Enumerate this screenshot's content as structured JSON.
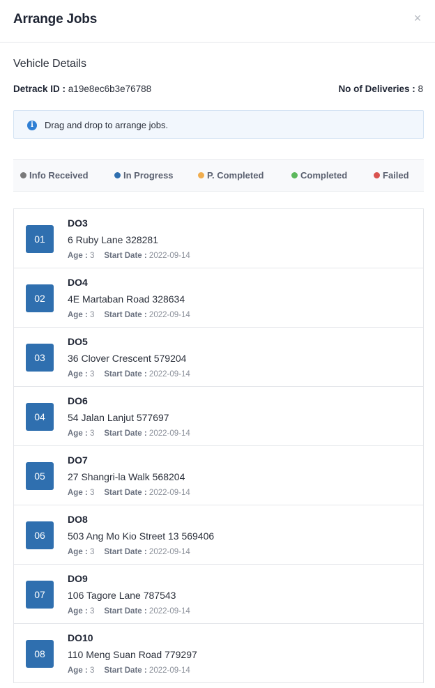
{
  "modal": {
    "title": "Arrange Jobs",
    "close_label": "×"
  },
  "vehicle": {
    "section_title": "Vehicle Details",
    "detrack_label": "Detrack ID :",
    "detrack_id": "a19e8ec6b3e76788",
    "deliveries_label": "No of Deliveries :",
    "deliveries_count": "8"
  },
  "info": {
    "icon": "info-icon",
    "text": "Drag and drop to arrange jobs."
  },
  "legend": [
    {
      "label": "Info Received",
      "color": "#7a7a7a"
    },
    {
      "label": "In Progress",
      "color": "#2f6faf"
    },
    {
      "label": "P. Completed",
      "color": "#f0ad4e"
    },
    {
      "label": "Completed",
      "color": "#5cb85c"
    },
    {
      "label": "Failed",
      "color": "#d9534f"
    }
  ],
  "meta_labels": {
    "age": "Age :",
    "start_date": "Start Date :"
  },
  "jobs": [
    {
      "index": "01",
      "code": "DO3",
      "address": "6 Ruby Lane 328281",
      "age": "3",
      "start_date": "2022-09-14"
    },
    {
      "index": "02",
      "code": "DO4",
      "address": "4E Martaban Road 328634",
      "age": "3",
      "start_date": "2022-09-14"
    },
    {
      "index": "03",
      "code": "DO5",
      "address": "36 Clover Crescent 579204",
      "age": "3",
      "start_date": "2022-09-14"
    },
    {
      "index": "04",
      "code": "DO6",
      "address": "54 Jalan Lanjut 577697",
      "age": "3",
      "start_date": "2022-09-14"
    },
    {
      "index": "05",
      "code": "DO7",
      "address": "27 Shangri-la Walk 568204",
      "age": "3",
      "start_date": "2022-09-14"
    },
    {
      "index": "06",
      "code": "DO8",
      "address": "503 Ang Mo Kio Street 13 569406",
      "age": "3",
      "start_date": "2022-09-14"
    },
    {
      "index": "07",
      "code": "DO9",
      "address": "106 Tagore Lane 787543",
      "age": "3",
      "start_date": "2022-09-14"
    },
    {
      "index": "08",
      "code": "DO10",
      "address": "110 Meng Suan Road 779297",
      "age": "3",
      "start_date": "2022-09-14"
    }
  ]
}
